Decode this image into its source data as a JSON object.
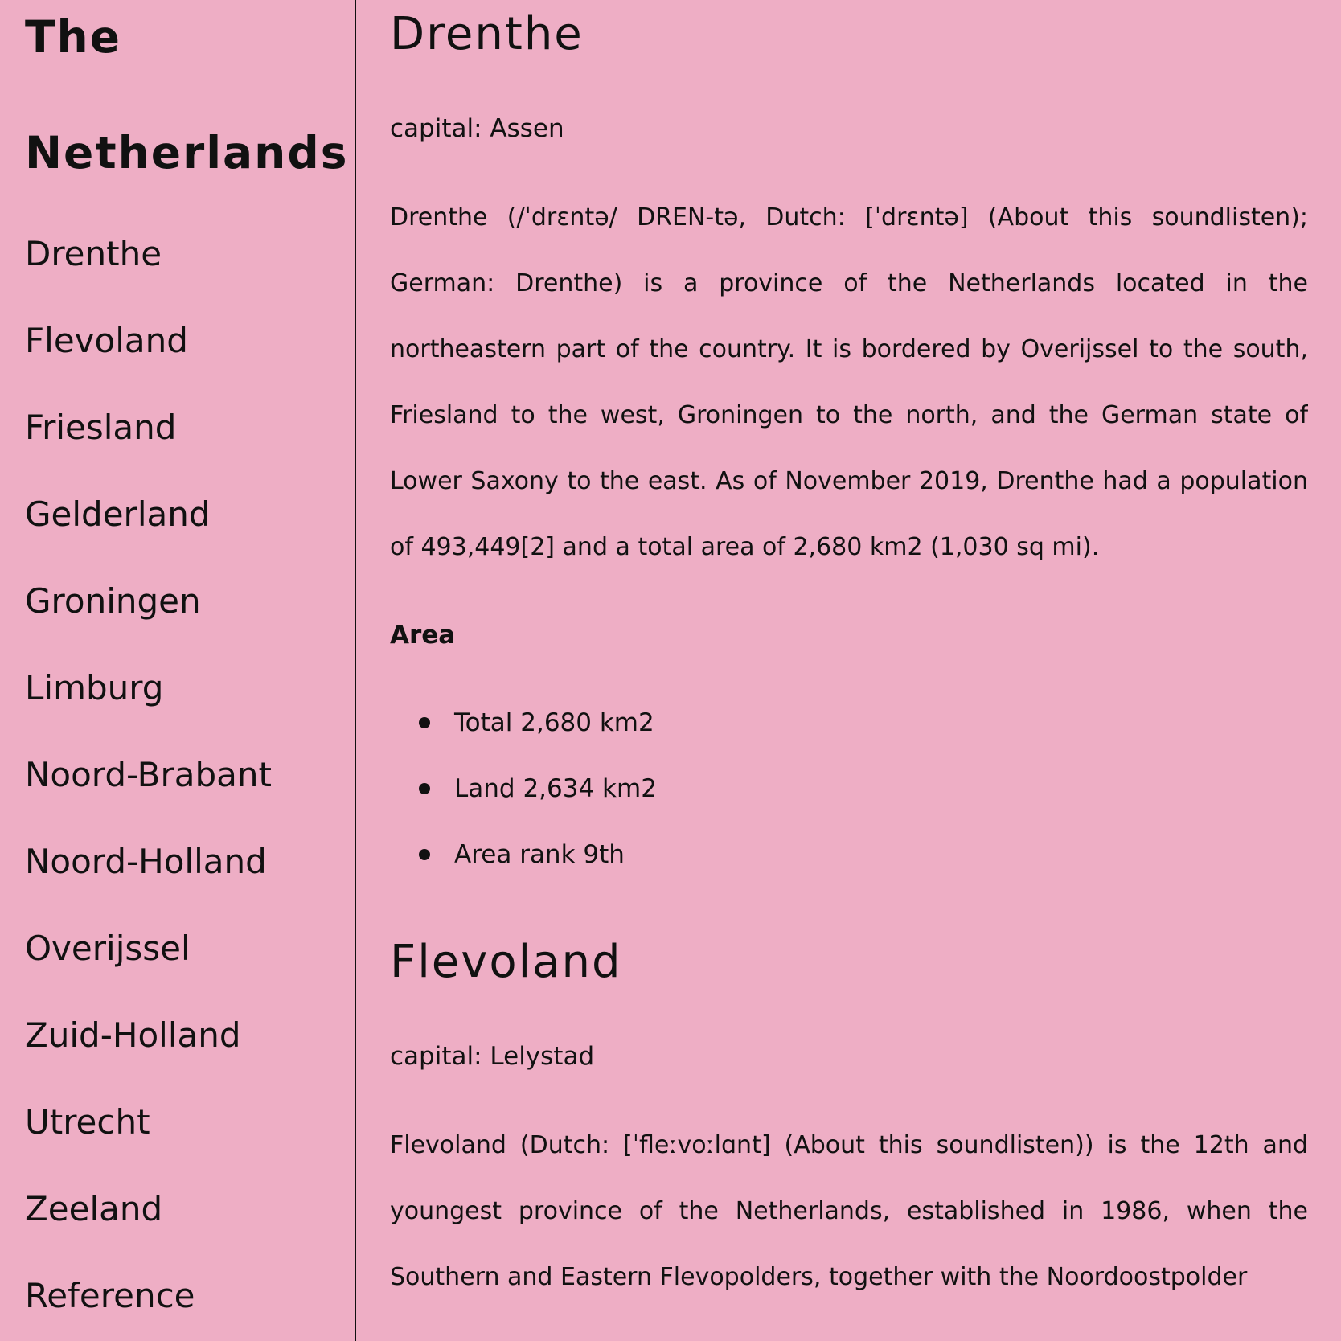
{
  "sidebar": {
    "title": "The Netherlands",
    "items": [
      {
        "label": "Drenthe"
      },
      {
        "label": "Flevoland"
      },
      {
        "label": "Friesland"
      },
      {
        "label": "Gelderland"
      },
      {
        "label": "Groningen"
      },
      {
        "label": "Limburg"
      },
      {
        "label": "Noord-Brabant"
      },
      {
        "label": "Noord-Holland"
      },
      {
        "label": "Overijssel"
      },
      {
        "label": "Zuid-Holland"
      },
      {
        "label": "Utrecht"
      },
      {
        "label": "Zeeland"
      },
      {
        "label": "Reference"
      }
    ]
  },
  "sections": [
    {
      "title": "Drenthe",
      "capital": "capital: Assen",
      "description": "Drenthe (/ˈdrɛntə/ DREN-tə, Dutch: [ˈdrɛntə] (About this soundlisten); German: Drenthe) is a province of the Netherlands located in the northeastern part of the country. It is bordered by Overijssel to the south, Friesland to the west, Groningen to the north, and the German state of Lower Saxony to the east. As of November 2019, Drenthe had a population of 493,449[2] and a total area of 2,680 km2 (1,030 sq mi).",
      "area_heading": "Area",
      "area_items": [
        "Total 2,680 km2",
        "Land 2,634 km2",
        "Area rank 9th"
      ]
    },
    {
      "title": "Flevoland",
      "capital": "capital: Lelystad",
      "description": "Flevoland (Dutch: [ˈfleːvoːlɑnt] (About this soundlisten)) is the 12th and youngest province of the Netherlands, established in 1986, when the Southern and Eastern Flevopolders, together with the Noordoostpolder"
    }
  ],
  "colors": {
    "background": "#eeaec5",
    "text": "#111111"
  }
}
